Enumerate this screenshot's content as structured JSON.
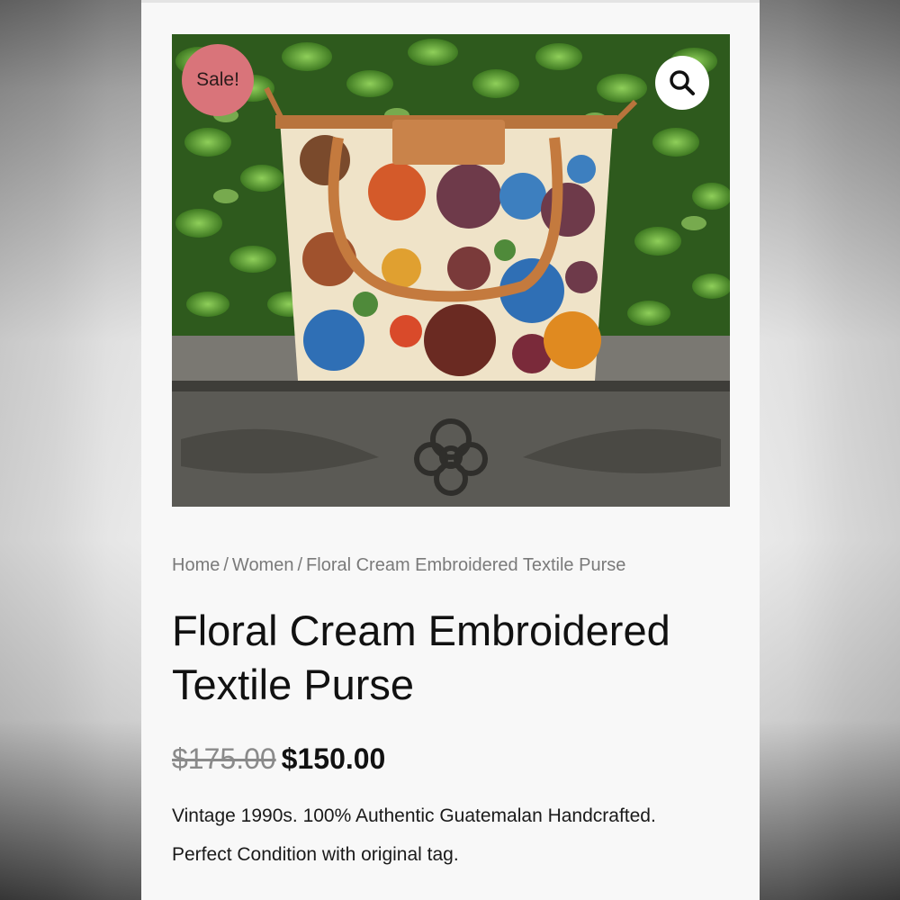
{
  "product": {
    "sale_badge": "Sale!",
    "image_alt": "Floral embroidered textile purse with leather handles on a carved stone ledge",
    "zoom_icon": "search-icon"
  },
  "breadcrumb": {
    "items": [
      "Home",
      "Women",
      "Floral Cream Embroidered Textile Purse"
    ],
    "separator": "/"
  },
  "title": "Floral Cream Embroidered Textile Purse",
  "price": {
    "regular": "$175.00",
    "sale": "$150.00"
  },
  "description": {
    "line1": "Vintage 1990s. 100% Authentic Guatemalan Handcrafted.",
    "line2": "Perfect Condition with original tag."
  },
  "colors": {
    "sale_badge": "#d9747a",
    "page_background": "#f8f8f8"
  }
}
